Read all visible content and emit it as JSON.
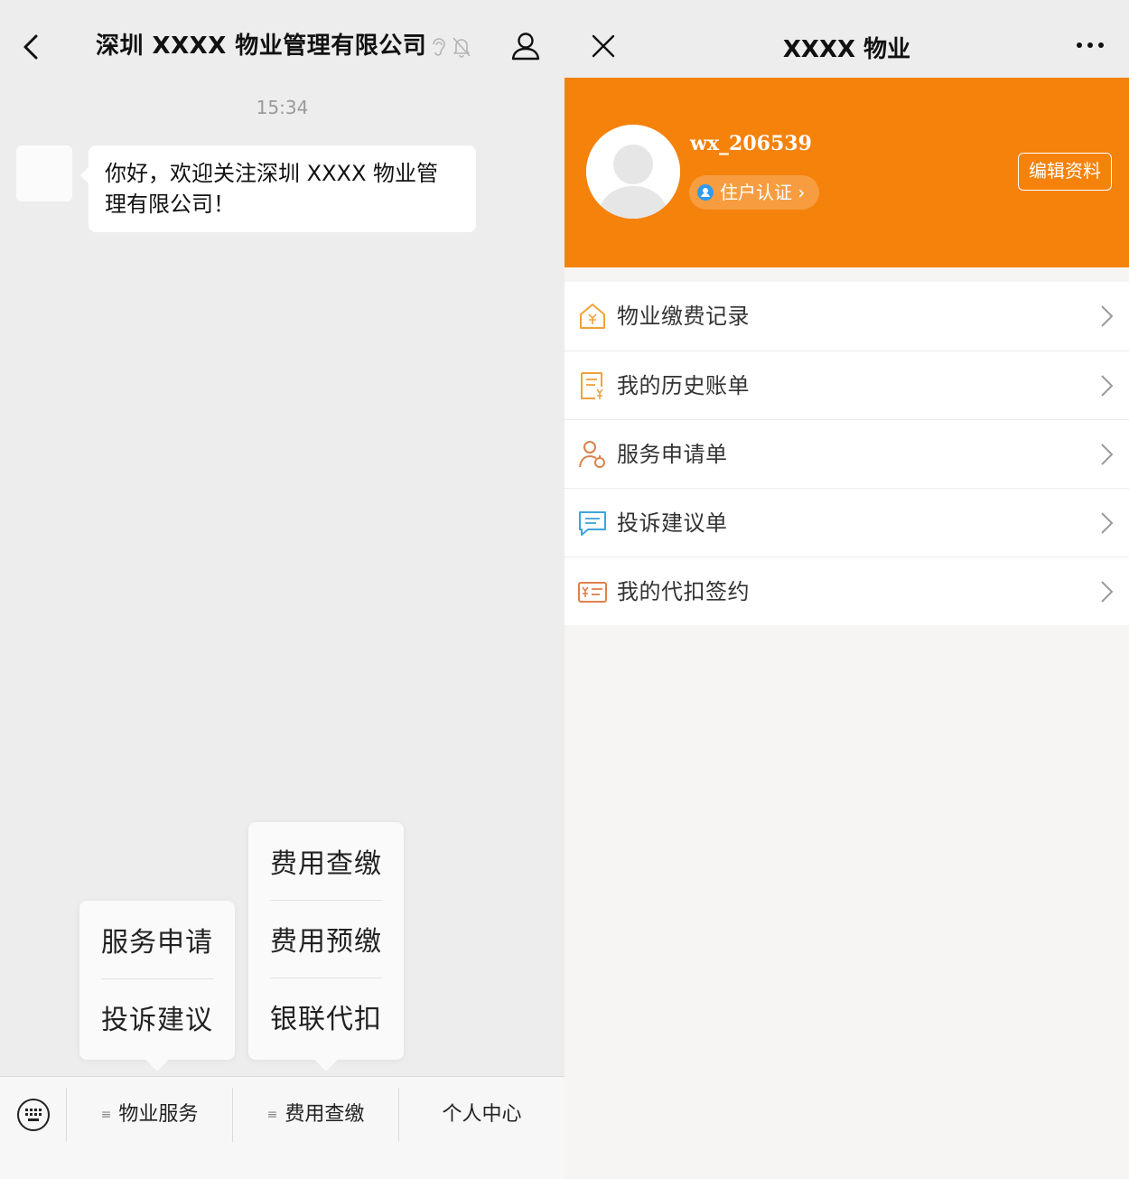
{
  "left": {
    "chat_title": "深圳 XXXX 物业管理有限公司",
    "timestamp": "15:34",
    "message": "你好，欢迎关注深圳 XXXX 物业管理有限公司！",
    "popup_service": [
      "服务申请",
      "投诉建议"
    ],
    "popup_fee": [
      "费用查缴",
      "费用预缴",
      "银联代扣"
    ],
    "menu": {
      "property_service": "物业服务",
      "fee_inquiry": "费用查缴",
      "personal_center": "个人中心"
    },
    "icons": [
      "back-arrow-icon",
      "ear-icon",
      "mute-bell-icon",
      "person-icon",
      "keyboard-icon"
    ]
  },
  "right": {
    "title": "XXXX 物业",
    "username": "wx_206539",
    "verify_label": "住户认证",
    "edit_label": "编辑资料",
    "accent_color": "#f5820b",
    "items": [
      {
        "label": "物业缴费记录",
        "icon": "house-yen-icon"
      },
      {
        "label": "我的历史账单",
        "icon": "bill-icon"
      },
      {
        "label": "服务申请单",
        "icon": "service-person-icon"
      },
      {
        "label": "投诉建议单",
        "icon": "chat-bubble-icon"
      },
      {
        "label": "我的代扣签约",
        "icon": "yen-card-icon"
      }
    ]
  }
}
